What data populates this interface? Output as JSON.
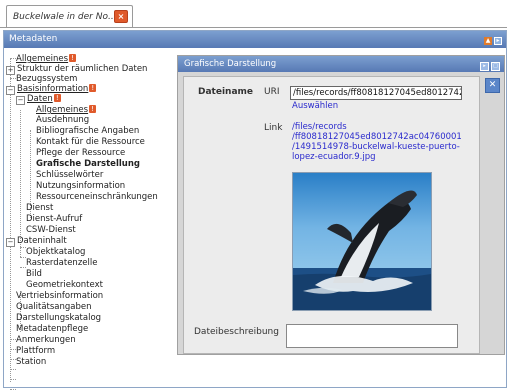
{
  "tab": {
    "title": "Buckelwale in der No...",
    "close_icon": "close-icon"
  },
  "main": {
    "title": "Metadaten"
  },
  "tree": {
    "allgemeines": "Allgemeines",
    "struktur": "Struktur der räumlichen Daten",
    "bezugssystem": "Bezugssystem",
    "basisinformation": "Basisinformation",
    "daten": "Daten",
    "daten_allgemeines": "Allgemeines",
    "ausdehnung": "Ausdehnung",
    "bibliografische": "Bibliografische Angaben",
    "kontakt": "Kontakt für die Ressource",
    "pflege": "Pflege der Ressource",
    "grafische": "Grafische Darstellung",
    "schluesselwoerter": "Schlüsselwörter",
    "nutzung": "Nutzungsinformation",
    "ressourceneinschr": "Ressourceneinschränkungen",
    "dienst": "Dienst",
    "dienst_aufruf": "Dienst-Aufruf",
    "csw_dienst": "CSW-Dienst",
    "dateninhalt": "Dateninhalt",
    "objektkatalog": "Objektkatalog",
    "rasterdatenzelle": "Rasterdatenzelle",
    "bild": "Bild",
    "geometriekontext": "Geometriekontext",
    "vertriebsinformation": "Vertriebsinformation",
    "qualitaetsangaben": "Qualitätsangaben",
    "darstellungskatalog": "Darstellungskatalog",
    "metadatenpflege": "Metadatenpflege",
    "anmerkungen": "Anmerkungen",
    "plattform": "Plattform",
    "station": "Station"
  },
  "dialog": {
    "title": "Grafische Darstellung",
    "dateiname_label": "Dateiname",
    "uri_label": "URI",
    "uri_value": "/files/records/ff80818127045ed8012742a",
    "auswaehlen": "Auswählen",
    "link_label": "Link",
    "link_lines": [
      "/files/records",
      "/ff80818127045ed8012742ac04760001",
      "/1491514978-buckelwal-kueste-puerto-",
      "lopez-ecuador.9.jpg"
    ],
    "dateibeschreibung_label": "Dateibeschreibung"
  },
  "colors": {
    "accent": "#5779b4",
    "warning": "#e05a2b",
    "link": "#2a2acd"
  }
}
